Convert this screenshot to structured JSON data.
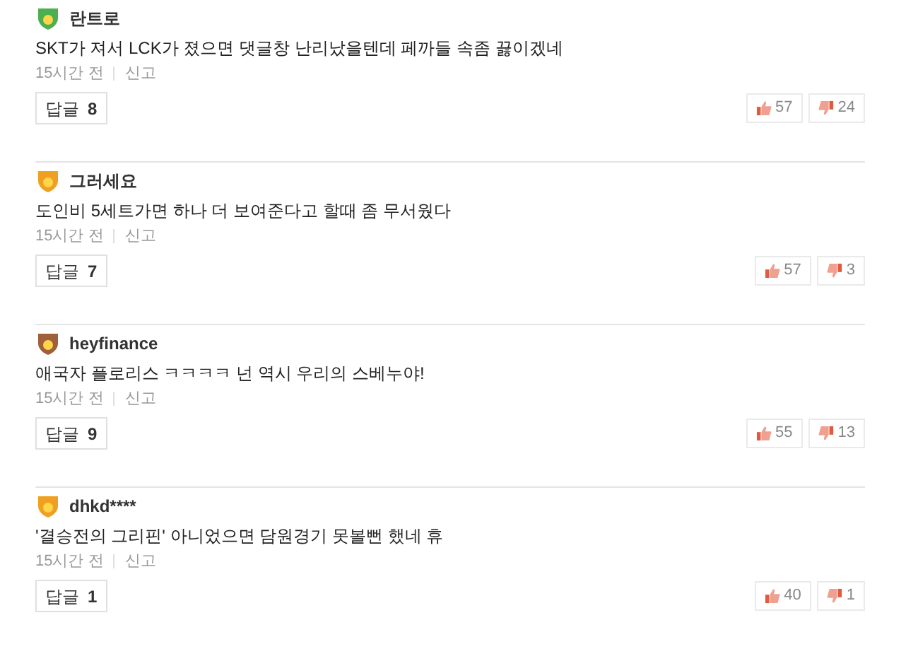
{
  "comments": [
    {
      "user": "란트로",
      "color": "#4caf50",
      "text": "SKT가 져서 LCK가 졌으면 댓글창 난리났을텐데 페까들 속좀 끓이겠네",
      "time": "15시간 전",
      "report": "신고",
      "reply_label": "답글",
      "reply_count": "8",
      "likes": "57",
      "dislikes": "24"
    },
    {
      "user": "그러세요",
      "color": "#f0a020",
      "text": "도인비 5세트가면 하나 더 보여준다고 할때 좀 무서웠다",
      "time": "15시간 전",
      "report": "신고",
      "reply_label": "답글",
      "reply_count": "7",
      "likes": "57",
      "dislikes": "3"
    },
    {
      "user": "heyfinance",
      "color": "#a0603a",
      "text": "애국자 플로리스 ㅋㅋㅋㅋ 넌 역시 우리의 스베누야!",
      "time": "15시간 전",
      "report": "신고",
      "reply_label": "답글",
      "reply_count": "9",
      "likes": "55",
      "dislikes": "13"
    },
    {
      "user": "dhkd****",
      "color": "#f0a020",
      "text": "'결승전의 그리핀' 아니었으면 담원경기 못볼뻔 했네 휴",
      "time": "15시간 전",
      "report": "신고",
      "reply_label": "답글",
      "reply_count": "1",
      "likes": "40",
      "dislikes": "1"
    }
  ]
}
